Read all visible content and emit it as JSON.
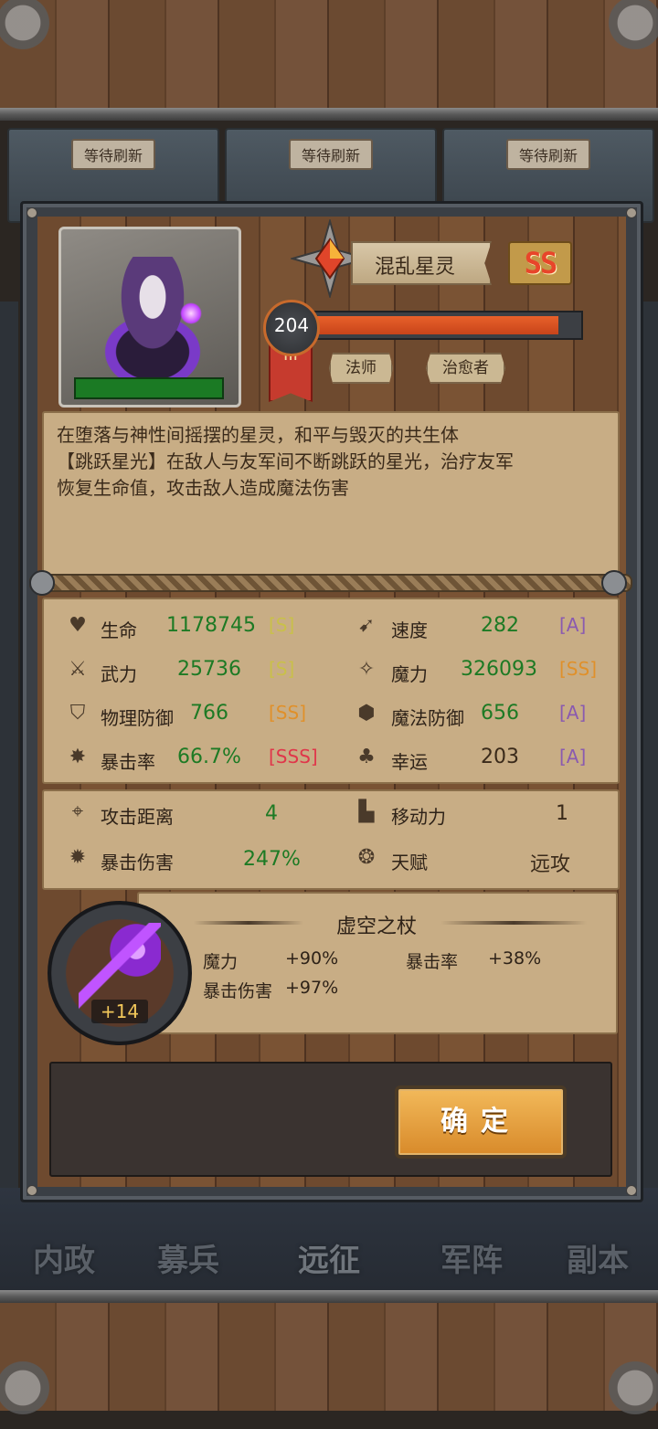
{
  "background": {
    "refresh_cards": [
      {
        "label": "等待刷新"
      },
      {
        "label": "等待刷新"
      },
      {
        "label": "等待刷新"
      }
    ],
    "nav": [
      "内政",
      "募兵",
      "远征",
      "军阵",
      "副本"
    ]
  },
  "hero": {
    "name": "混乱星灵",
    "grade": "SS",
    "level": "204",
    "exp_fraction": 0.94,
    "tier": "III",
    "tags": [
      "法师",
      "治愈者"
    ],
    "description": [
      "在堕落与神性间摇摆的星灵，和平与毁灭的共生体",
      "【跳跃星光】在敌人与友军间不断跳跃的星光，治疗友军",
      "恢复生命值，攻击敌人造成魔法伤害"
    ]
  },
  "stats": {
    "left": [
      {
        "icon": "heart-icon",
        "label": "生命",
        "value": "1178745",
        "grade": "[S]",
        "grade_color": "#c9c04a"
      },
      {
        "icon": "sword-icon",
        "label": "武力",
        "value": "25736",
        "grade": "[S]",
        "grade_color": "#c9c04a"
      },
      {
        "icon": "shield-icon",
        "label": "物理防御",
        "value": "766",
        "grade": "[SS]",
        "grade_color": "#e0902a"
      },
      {
        "icon": "burst-icon",
        "label": "暴击率",
        "value": "66.7%",
        "grade": "[SSS]",
        "grade_color": "#e0364a"
      }
    ],
    "right": [
      {
        "icon": "speed-icon",
        "label": "速度",
        "value": "282",
        "grade": "[A]",
        "grade_color": "#8a5ab0",
        "dark": false
      },
      {
        "icon": "magic-icon",
        "label": "魔力",
        "value": "326093",
        "grade": "[SS]",
        "grade_color": "#e0902a",
        "dark": false
      },
      {
        "icon": "magic-shield-icon",
        "label": "魔法防御",
        "value": "656",
        "grade": "[A]",
        "grade_color": "#8a5ab0",
        "dark": false
      },
      {
        "icon": "clover-icon",
        "label": "幸运",
        "value": "203",
        "grade": "[A]",
        "grade_color": "#8a5ab0",
        "dark": true
      }
    ],
    "extra": {
      "attack_range": {
        "label": "攻击距离",
        "value": "4"
      },
      "crit_damage": {
        "label": "暴击伤害",
        "value": "247%"
      },
      "movement": {
        "label": "移动力",
        "value": "1"
      },
      "talent": {
        "label": "天赋",
        "value": "远攻"
      }
    }
  },
  "equipment": {
    "name": "虚空之杖",
    "level": "+14",
    "bonuses": {
      "magic": {
        "label": "魔力",
        "value": "+90%"
      },
      "crit_rate": {
        "label": "暴击率",
        "value": "+38%"
      },
      "crit_damage": {
        "label": "暴击伤害",
        "value": "+97%"
      }
    }
  },
  "confirm_label": "确定"
}
